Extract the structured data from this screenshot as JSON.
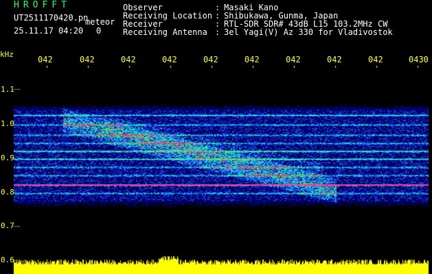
{
  "header": {
    "app_name": "HROFFT",
    "filename": "UT2511170420.pn",
    "meteor_label": "meteor",
    "datetime": "25.11.17 04:20",
    "count": "0",
    "info": [
      {
        "label": "Observer",
        "sep": ":",
        "value": "Masaki Kano"
      },
      {
        "label": "Receiving Location",
        "sep": ":",
        "value": "Shibukawa, Gunma, Japan"
      },
      {
        "label": "Receiver",
        "sep": ":",
        "value": "RTL-SDR SDR# 43dB L15 103.2MHz CW"
      },
      {
        "label": "Receiving Antenna",
        "sep": ":",
        "value": "3el Yagi(V) Az 330 for Vladivostok"
      }
    ]
  },
  "axis": {
    "unit": "kHz",
    "y_ticks": [
      "1.1",
      "1.0",
      "0.9",
      "0.8",
      "0.7",
      "0.6"
    ],
    "time_ticks": [
      "042",
      "042",
      "042",
      "042",
      "042",
      "042",
      "042",
      "042",
      "042",
      "0430"
    ]
  },
  "colors": {
    "background": "#000000",
    "noise_floor": "#00007a",
    "signal_low": "#2080ff",
    "signal_mid": "#20ff60",
    "signal_high": "#ff2070",
    "level_bar": "#ffff00",
    "text_header": "#ffffff",
    "text_axis": "#ffff33",
    "text_title": "#33ff55"
  }
}
